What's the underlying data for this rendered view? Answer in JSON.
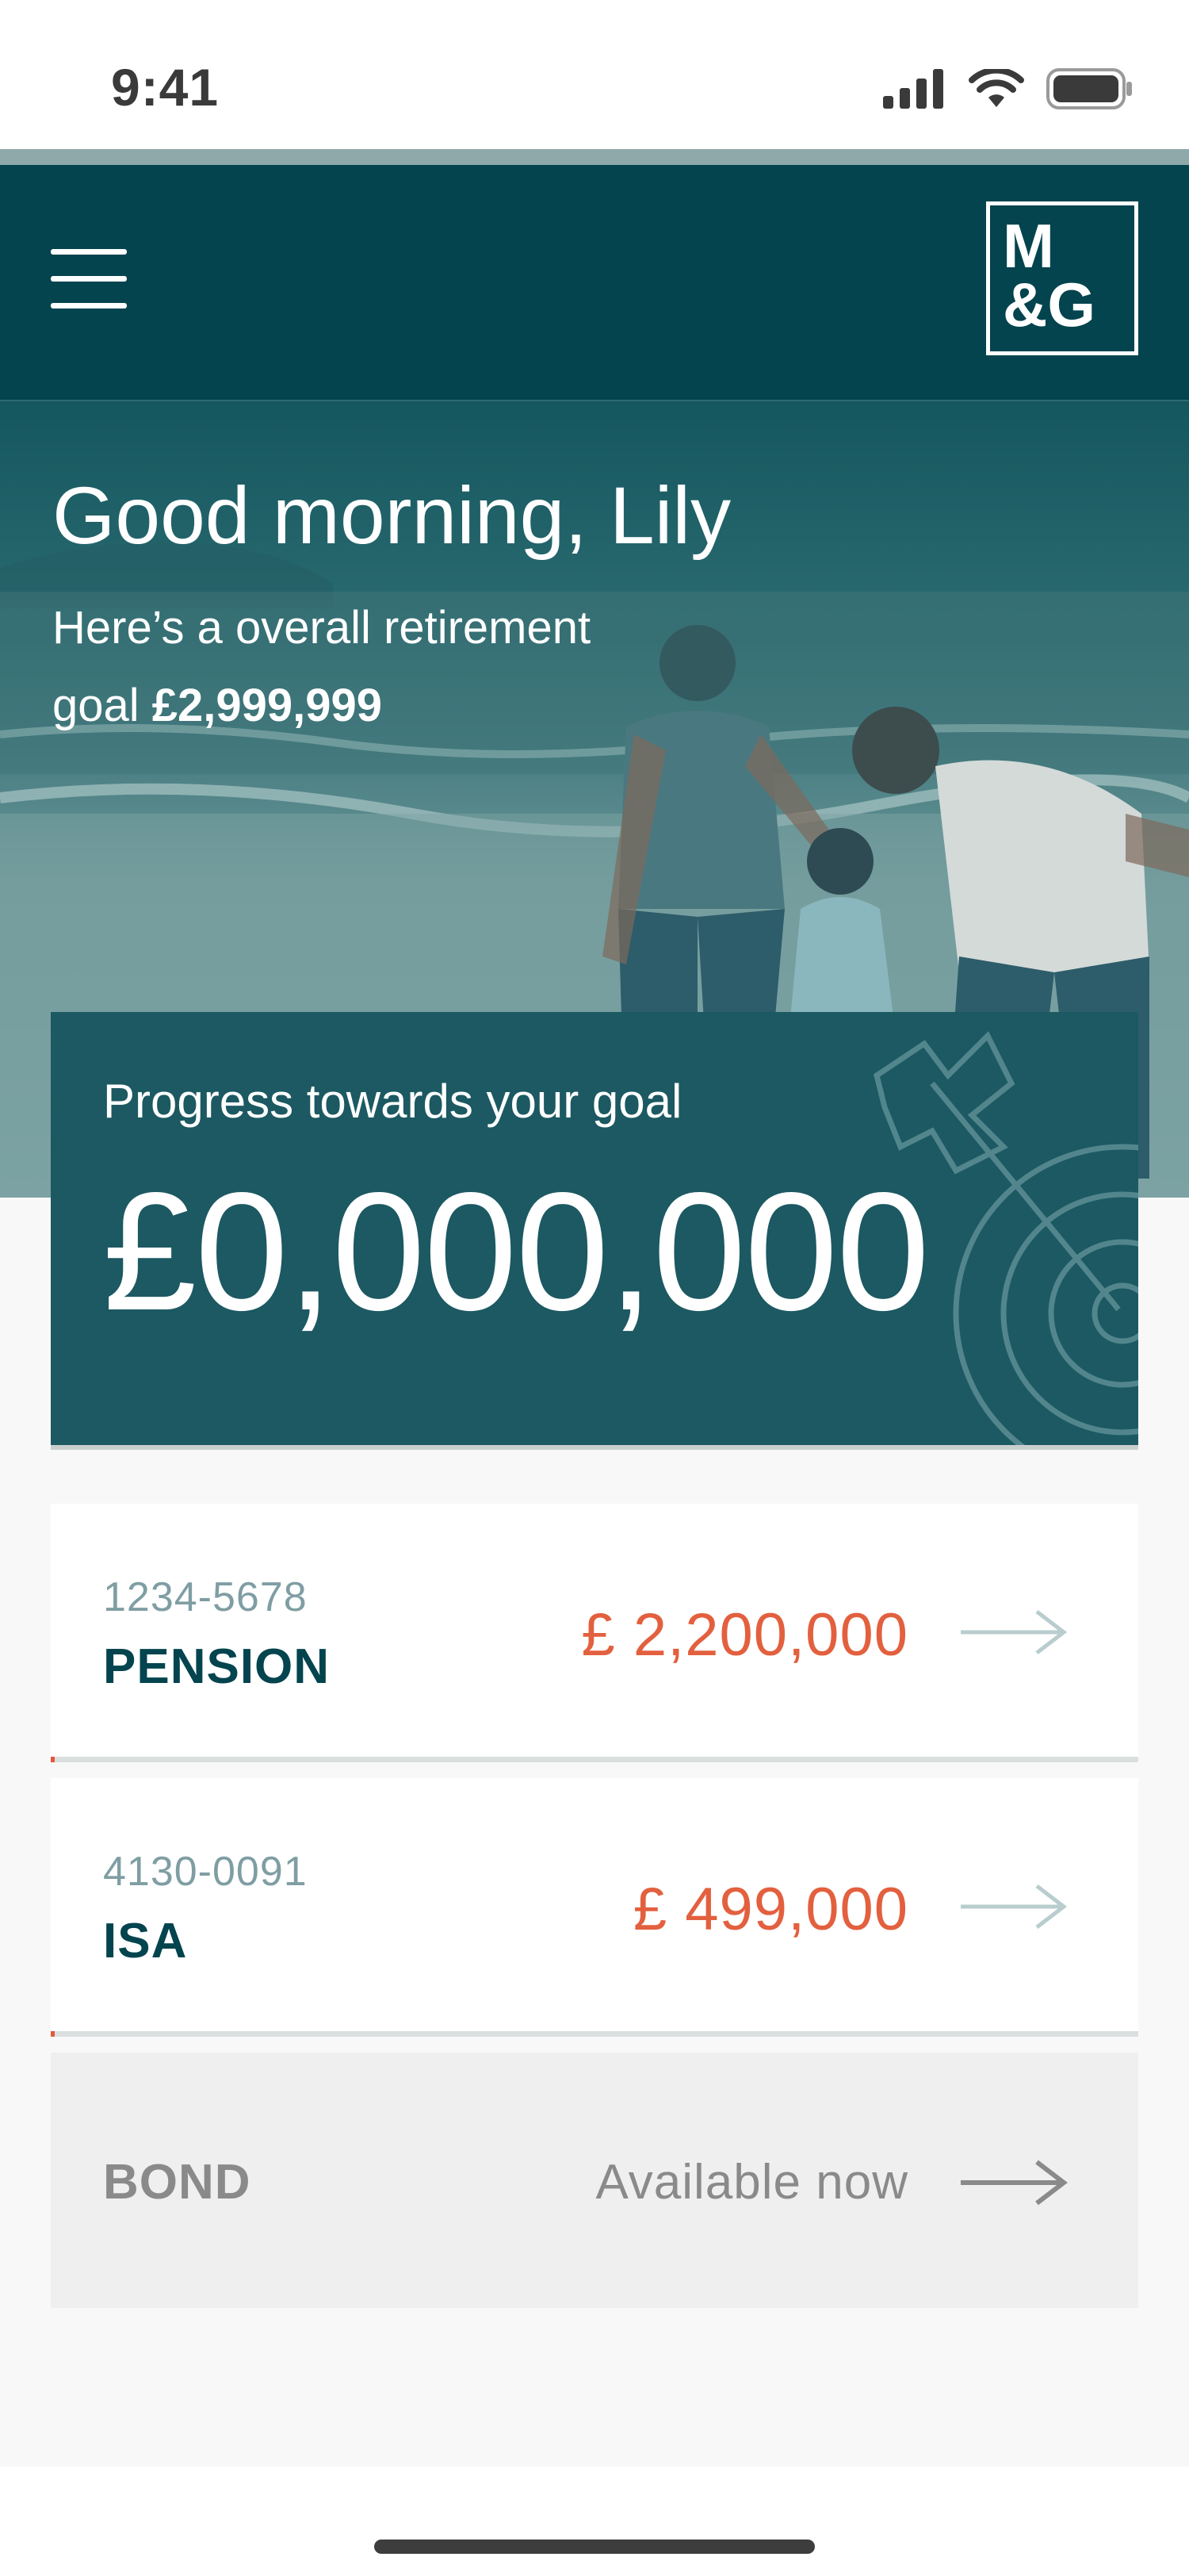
{
  "status_bar": {
    "time": "9:41",
    "icons": [
      "cellular-signal-icon",
      "wifi-icon",
      "battery-icon"
    ]
  },
  "header": {
    "menu_icon": "hamburger-menu-icon",
    "logo_text": "M&G"
  },
  "hero": {
    "greeting": "Good morning, Lily",
    "goal_prefix": "Here’s a overall retirement",
    "goal_word": "goal",
    "goal_amount": "£2,999,999"
  },
  "progress": {
    "label": "Progress towards your goal",
    "value": "£0,000,000",
    "icon": "target-arrow-icon"
  },
  "accounts": [
    {
      "number": "1234-5678",
      "type": "PENSION",
      "value": "£ 2,200,000",
      "icon": "arrow-right-icon"
    },
    {
      "number": "4130-0091",
      "type": "ISA",
      "value": "£ 499,000",
      "icon": "arrow-right-icon"
    }
  ],
  "bond": {
    "type": "BOND",
    "status": "Available now",
    "icon": "arrow-right-icon"
  },
  "colors": {
    "header_bg": "#03444e",
    "card_bg": "#1c5962",
    "accent_value": "#e3603f",
    "account_type": "#03444e"
  }
}
